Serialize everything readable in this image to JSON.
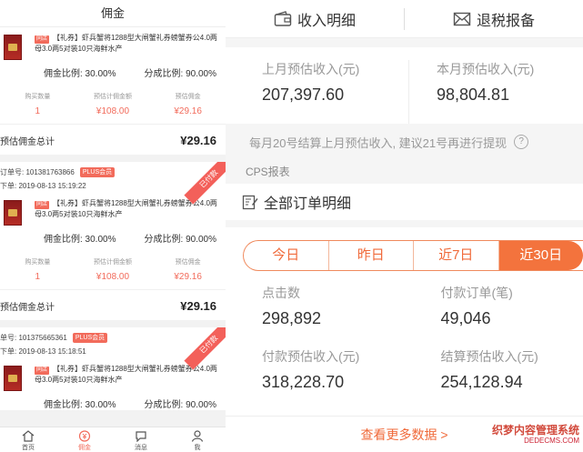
{
  "left": {
    "header": "佣金",
    "cards": [
      {
        "has_meta": false,
        "product_tag": "同店",
        "product_title": "【礼券】虾兵蟹将1288型大闸蟹礼券螃蟹券公4.0两母3.0两5对装10只海鲜水产",
        "commission_ratio": "佣金比例: 30.00%",
        "share_ratio": "分成比例: 90.00%",
        "stats": [
          {
            "label": "购买数量",
            "value": "1"
          },
          {
            "label": "预估计佣金额",
            "value": "¥108.00"
          },
          {
            "label": "预估佣金",
            "value": "¥29.16"
          }
        ],
        "total_label": "预估佣金总计",
        "total_value": "¥29.16"
      },
      {
        "has_meta": true,
        "order_no": "订单号: 101381763866",
        "plus": "PLUS会员",
        "order_time": "下单: 2019-08-13 15:19:22",
        "ribbon": "已付款",
        "product_tag": "同店",
        "product_title": "【礼券】虾兵蟹将1288型大闸蟹礼券螃蟹券公4.0两母3.0两5对装10只海鲜水产",
        "commission_ratio": "佣金比例: 30.00%",
        "share_ratio": "分成比例: 90.00%",
        "stats": [
          {
            "label": "购买数量",
            "value": "1"
          },
          {
            "label": "预估计佣金额",
            "value": "¥108.00"
          },
          {
            "label": "预估佣金",
            "value": "¥29.16"
          }
        ],
        "total_label": "预估佣金总计",
        "total_value": "¥29.16"
      },
      {
        "has_meta": true,
        "order_no": "单号: 101375665361",
        "plus": "PLUS会员",
        "order_time": "下单: 2019-08-13 15:18:51",
        "ribbon": "已付款",
        "product_tag": "同店",
        "product_title": "【礼券】虾兵蟹将1288型大闸蟹礼券螃蟹券公4.0两母3.0两5对装10只海鲜水产",
        "commission_ratio": "佣金比例: 30.00%",
        "share_ratio": "分成比例: 90.00%"
      }
    ],
    "tabbar": [
      {
        "label": "首页",
        "icon": "home-icon"
      },
      {
        "label": "佣金",
        "icon": "commission-icon"
      },
      {
        "label": "消息",
        "icon": "message-icon"
      },
      {
        "label": "我",
        "icon": "profile-icon"
      }
    ]
  },
  "right": {
    "tabs": [
      {
        "label": "收入明细",
        "icon": "wallet-icon"
      },
      {
        "label": "退税报备",
        "icon": "mail-icon"
      }
    ],
    "income": [
      {
        "label": "上月预估收入(元)",
        "value": "207,397.60"
      },
      {
        "label": "本月预估收入(元)",
        "value": "98,804.81"
      }
    ],
    "notice": "每月20号结算上月预估收入, 建议21号再进行提现",
    "cps_label": "CPS报表",
    "orders_title": "全部订单明细",
    "periods": [
      "今日",
      "昨日",
      "近7日",
      "近30日"
    ],
    "active_period": "近30日",
    "metrics": [
      {
        "label": "点击数",
        "value": "298,892"
      },
      {
        "label": "付款订单(笔)",
        "value": "49,046"
      },
      {
        "label": "付款预估收入(元)",
        "value": "318,228.70"
      },
      {
        "label": "结算预估收入(元)",
        "value": "254,128.94"
      }
    ],
    "more": "查看更多数据 >",
    "watermark": "织梦内容管理系统",
    "watermark_sub": "DEDECMS.COM"
  },
  "colors": {
    "accent": "#f3733d",
    "badge": "#f26b5b"
  }
}
